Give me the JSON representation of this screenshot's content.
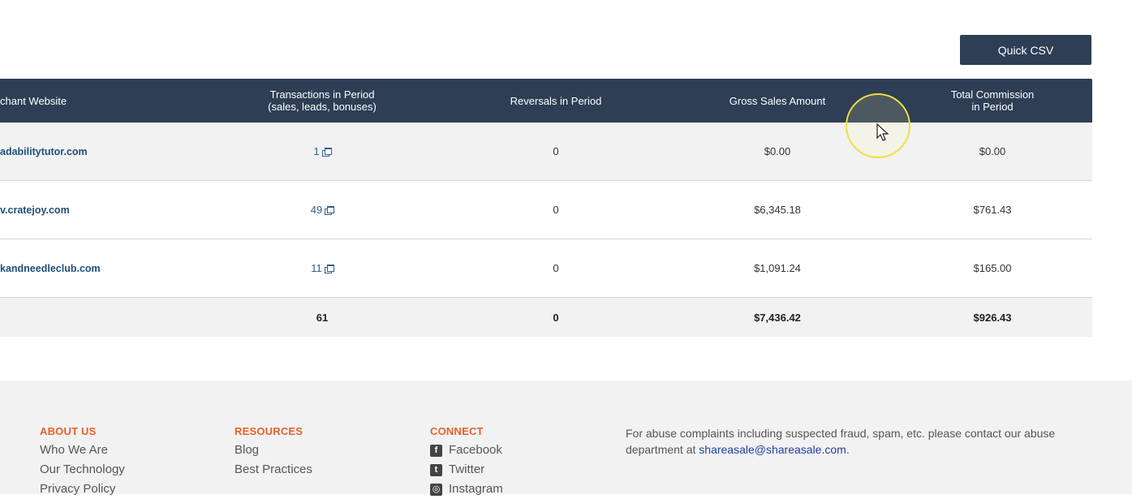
{
  "toolbar": {
    "quick_csv_label": "Quick CSV"
  },
  "table": {
    "headers": {
      "merchant": "chant Website",
      "transactions_line1": "Transactions in Period",
      "transactions_line2": "(sales, leads, bonuses)",
      "reversals": "Reversals in Period",
      "gross_sales": "Gross Sales Amount",
      "commission_line1": "Total Commission",
      "commission_line2": "in Period"
    },
    "rows": [
      {
        "merchant": "adabilitytutor.com",
        "transactions": "1",
        "reversals": "0",
        "gross_sales": "$0.00",
        "commission": "$0.00"
      },
      {
        "merchant": "v.cratejoy.com",
        "transactions": "49",
        "reversals": "0",
        "gross_sales": "$6,345.18",
        "commission": "$761.43"
      },
      {
        "merchant": "kandneedleclub.com",
        "transactions": "11",
        "reversals": "0",
        "gross_sales": "$1,091.24",
        "commission": "$165.00"
      }
    ],
    "totals": {
      "transactions": "61",
      "reversals": "0",
      "gross_sales": "$7,436.42",
      "commission": "$926.43"
    }
  },
  "footer": {
    "about": {
      "heading": "ABOUT US",
      "links": [
        "Who We Are",
        "Our Technology",
        "Privacy Policy"
      ]
    },
    "resources": {
      "heading": "RESOURCES",
      "links": [
        "Blog",
        "Best Practices"
      ]
    },
    "connect": {
      "heading": "CONNECT",
      "links": [
        "Facebook",
        "Twitter",
        "Instagram"
      ]
    },
    "abuse_text": "For abuse complaints including suspected fraud, spam, etc. please contact our abuse department at ",
    "abuse_email": "shareasale@shareasale.com",
    "abuse_end": "."
  },
  "colors": {
    "header_bg": "#2e3e55",
    "accent_orange": "#e8602c",
    "link_blue": "#2c5f92"
  },
  "icons": [
    "popup-window-icon",
    "facebook-icon",
    "twitter-icon",
    "instagram-icon",
    "mouse-cursor-icon"
  ]
}
